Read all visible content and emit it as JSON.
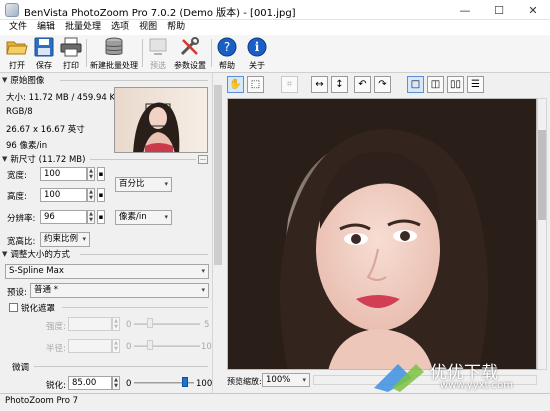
{
  "window": {
    "title": "BenVista PhotoZoom Pro 7.0.2 (Demo 版本) - [001.jpg]",
    "minimize": "—",
    "maximize": "☐",
    "close": "✕"
  },
  "menu": [
    "文件",
    "编辑",
    "批量处理",
    "选项",
    "视图",
    "帮助"
  ],
  "toolbar": [
    {
      "label": "打开",
      "icon": "folder-open-icon"
    },
    {
      "label": "保存",
      "icon": "floppy-disk-icon"
    },
    {
      "label": "打印",
      "icon": "printer-icon"
    },
    {
      "label": "新建批量处理",
      "icon": "database-stack-icon"
    },
    {
      "label": "预选",
      "icon": "preview-icon",
      "disabled": true
    },
    {
      "label": "参数设置",
      "icon": "tools-icon"
    },
    {
      "label": "帮助",
      "icon": "help-icon"
    },
    {
      "label": "关于",
      "icon": "info-icon"
    }
  ],
  "original": {
    "header": "原始图像",
    "size": "大小: 11.72 MB / 459.94 KB",
    "colormode": "RGB/8",
    "dimensions": "26.67 x 16.67 英寸",
    "resolution": "96 像素/in"
  },
  "newsize": {
    "header": "新尺寸 (11.72 MB)",
    "width_label": "宽度:",
    "width_value": "100",
    "height_label": "高度:",
    "height_value": "100",
    "unit_select": "百分比",
    "res_label": "分辨率:",
    "res_value": "96",
    "res_unit": "像素/in",
    "aspect_label": "宽高比:",
    "aspect_value": "约束比例"
  },
  "method": {
    "header": "调整大小的方式",
    "algorithm": "S-Spline Max",
    "preset_label": "预设:",
    "preset_value": "普通 *"
  },
  "unsharp": {
    "checkbox_label": "锐化遮罩",
    "strength_label": "强度:",
    "strength_min": "0",
    "strength_max": "5",
    "radius_label": "半径:",
    "radius_min": "0",
    "radius_max": "10"
  },
  "fine": {
    "header": "微调",
    "sharpen_label": "锐化:",
    "sharpen_value": "85.00",
    "sharpen_min": "0",
    "sharpen_max": "100",
    "sharpen_level": 0.85
  },
  "preview": {
    "zoom_label": "预览缩放:",
    "zoom_value": "100%"
  },
  "status": "PhotoZoom Pro 7",
  "watermark": {
    "text": "优优下载",
    "url": "www.yyxt.com"
  },
  "colors": {
    "accent": "#1e73d2",
    "help": "#1a5fc6"
  }
}
